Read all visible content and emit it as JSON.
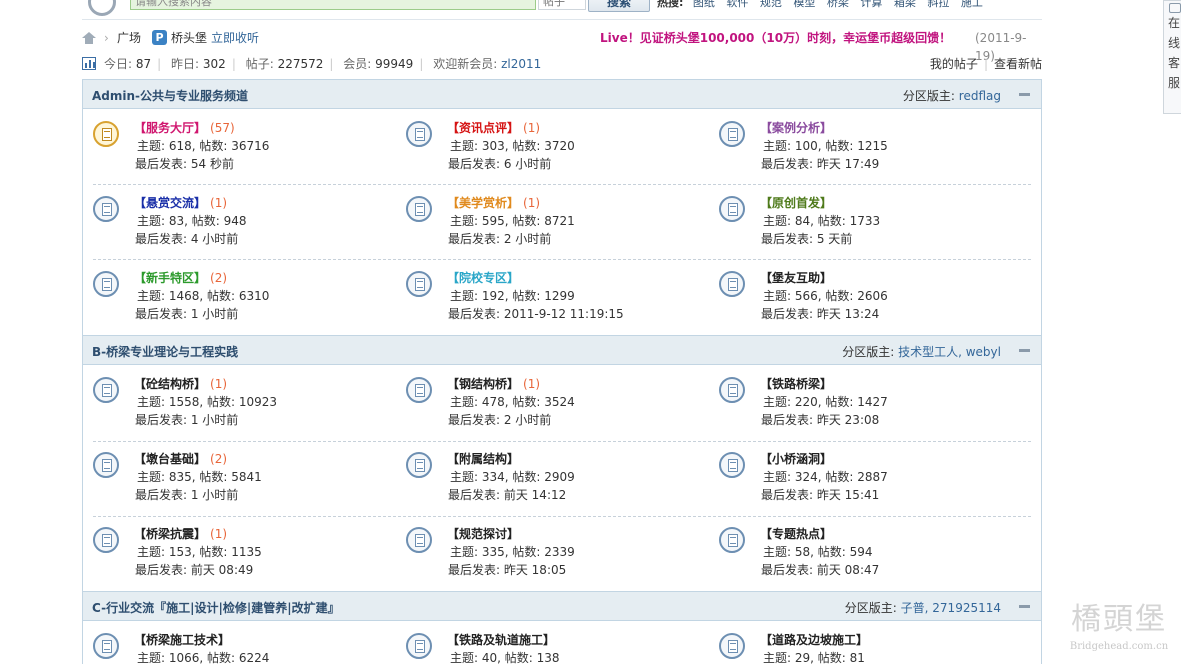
{
  "search": {
    "placeholder": "请输入搜索内容",
    "type": "帖子",
    "button": "搜索",
    "hot_label": "热搜:",
    "hot_terms": [
      "图纸",
      "软件",
      "规范",
      "模型",
      "桥梁",
      "计算",
      "箱梁",
      "斜拉",
      "施工"
    ]
  },
  "float_panel": {
    "text": [
      "在",
      "线",
      "客",
      "服"
    ]
  },
  "breadcrumb": {
    "plaza": "广场",
    "brand_icon": "P",
    "brand": "桥头堡",
    "favorite": "立即收听",
    "promo": "Live！见证桥头堡100,000（10万）时刻，幸运堡币超级回馈！",
    "promo_date": "(2011-9-19)"
  },
  "stats": {
    "today_label": "今日:",
    "today": "87",
    "yesterday_label": "昨日:",
    "yesterday": "302",
    "posts_label": "帖子:",
    "posts": "227572",
    "members_label": "会员:",
    "members": "99949",
    "welcome_label": "欢迎新会员:",
    "newest": "zl2011",
    "my_posts": "我的帖子",
    "new_posts": "查看新帖"
  },
  "colors": {
    "header_bg": "#e5edf2",
    "border": "#c2d5e3",
    "link": "#336699",
    "promo": "#c1147f",
    "today_count": "#e8663a"
  },
  "sections": [
    {
      "title": "Admin-公共与专业服务频道",
      "mod_label": "分区版主:",
      "mods": "redflag",
      "forums": [
        {
          "name": "【服务大厅】",
          "color": "#d0166f",
          "today": "(57)",
          "stats": "主题: 618, 帖数: 36716",
          "last": "最后发表: 54 秒前",
          "icon": "forum-new-icon"
        },
        {
          "name": "【资讯点评】",
          "color": "#d51313",
          "today": "(1)",
          "stats": "主题: 303, 帖数: 3720",
          "last": "最后发表: 6 小时前",
          "icon": "forum-icon"
        },
        {
          "name": "【案例分析】",
          "color": "#8a4b9e",
          "today": "",
          "stats": "主题: 100, 帖数: 1215",
          "last": "最后发表: 昨天 17:49",
          "icon": "forum-icon"
        },
        {
          "name": "【悬赏交流】",
          "color": "#1a2fa8",
          "today": "(1)",
          "stats": "主题: 83, 帖数: 948",
          "last": "最后发表: 4 小时前",
          "icon": "forum-icon"
        },
        {
          "name": "【美学赏析】",
          "color": "#e08a1e",
          "today": "(1)",
          "stats": "主题: 595, 帖数: 8721",
          "last": "最后发表: 2 小时前",
          "icon": "forum-icon"
        },
        {
          "name": "【原创首发】",
          "color": "#4e7a1a",
          "today": "",
          "stats": "主题: 84, 帖数: 1733",
          "last": "最后发表: 5 天前",
          "icon": "forum-icon"
        },
        {
          "name": "【新手特区】",
          "color": "#2c9a2c",
          "today": "(2)",
          "stats": "主题: 1468, 帖数: 6310",
          "last": "最后发表: 1 小时前",
          "icon": "forum-icon"
        },
        {
          "name": "【院校专区】",
          "color": "#2aa6c8",
          "today": "",
          "stats": "主题: 192, 帖数: 1299",
          "last": "最后发表: 2011-9-12 11:19:15",
          "icon": "forum-icon"
        },
        {
          "name": "【堡友互助】",
          "color": "#222222",
          "today": "",
          "stats": "主题: 566, 帖数: 2606",
          "last": "最后发表: 昨天 13:24",
          "icon": "forum-icon"
        }
      ]
    },
    {
      "title": "B-桥梁专业理论与工程实践",
      "mod_label": "分区版主:",
      "mods": "技术型工人, webyl",
      "forums": [
        {
          "name": "【砼结构桥】",
          "color": "#222222",
          "today": "(1)",
          "stats": "主题: 1558, 帖数: 10923",
          "last": "最后发表: 1 小时前",
          "icon": "forum-icon"
        },
        {
          "name": "【钢结构桥】",
          "color": "#222222",
          "today": "(1)",
          "stats": "主题: 478, 帖数: 3524",
          "last": "最后发表: 2 小时前",
          "icon": "forum-icon"
        },
        {
          "name": "【铁路桥梁】",
          "color": "#222222",
          "today": "",
          "stats": "主题: 220, 帖数: 1427",
          "last": "最后发表: 昨天 23:08",
          "icon": "forum-icon"
        },
        {
          "name": "【墩台基础】",
          "color": "#222222",
          "today": "(2)",
          "stats": "主题: 835, 帖数: 5841",
          "last": "最后发表: 1 小时前",
          "icon": "forum-icon"
        },
        {
          "name": "【附属结构】",
          "color": "#222222",
          "today": "",
          "stats": "主题: 334, 帖数: 2909",
          "last": "最后发表: 前天 14:12",
          "icon": "forum-icon"
        },
        {
          "name": "【小桥涵洞】",
          "color": "#222222",
          "today": "",
          "stats": "主题: 324, 帖数: 2887",
          "last": "最后发表: 昨天 15:41",
          "icon": "forum-icon"
        },
        {
          "name": "【桥梁抗震】",
          "color": "#222222",
          "today": "(1)",
          "stats": "主题: 153, 帖数: 1135",
          "last": "最后发表: 前天 08:49",
          "icon": "forum-icon"
        },
        {
          "name": "【规范探讨】",
          "color": "#222222",
          "today": "",
          "stats": "主题: 335, 帖数: 2339",
          "last": "最后发表: 昨天 18:05",
          "icon": "forum-icon"
        },
        {
          "name": "【专题热点】",
          "color": "#222222",
          "today": "",
          "stats": "主题: 58, 帖数: 594",
          "last": "最后发表: 前天 08:47",
          "icon": "forum-icon"
        }
      ]
    },
    {
      "title": "C-行业交流『施工|设计|检修|建管养|改扩建』",
      "mod_label": "分区版主:",
      "mods": "子普, 271925114",
      "forums": [
        {
          "name": "【桥梁施工技术】",
          "color": "#222222",
          "today": "",
          "stats": "主题: 1066, 帖数: 6224",
          "last": "",
          "icon": "forum-icon"
        },
        {
          "name": "【铁路及轨道施工】",
          "color": "#222222",
          "today": "",
          "stats": "主题: 40, 帖数: 138",
          "last": "",
          "icon": "forum-icon"
        },
        {
          "name": "【道路及边坡施工】",
          "color": "#222222",
          "today": "",
          "stats": "主题: 29, 帖数: 81",
          "last": "",
          "icon": "forum-icon"
        }
      ]
    }
  ],
  "watermark": {
    "logo": "橋頭堡",
    "url": "Bridgehead.com.cn"
  }
}
